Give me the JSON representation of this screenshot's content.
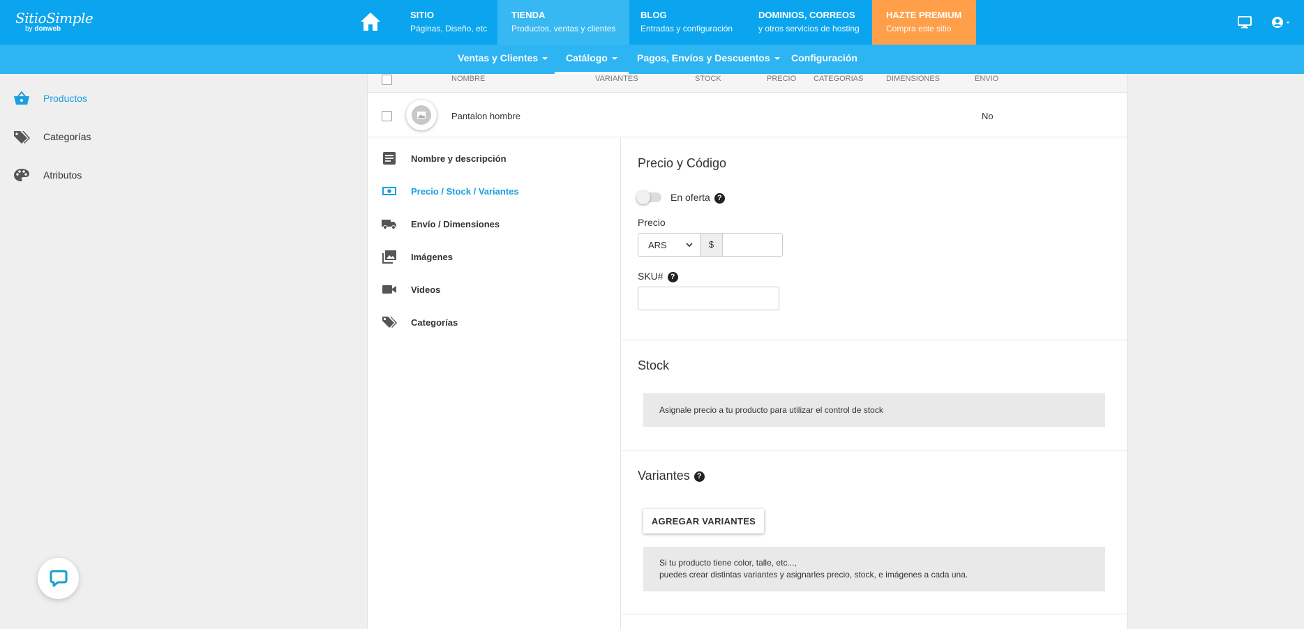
{
  "brand": {
    "logo_main": "SitioSimple",
    "logo_by": "by",
    "logo_company": "donweb"
  },
  "topnav": [
    {
      "title": "SITIO",
      "subtitle": "Páginas, Diseño, etc"
    },
    {
      "title": "TIENDA",
      "subtitle": "Productos, ventas y clientes"
    },
    {
      "title": "BLOG",
      "subtitle": "Entradas y configuración"
    },
    {
      "title": "DOMINIOS, CORREOS",
      "subtitle": "y otros servicios de hosting"
    },
    {
      "title": "HAZTE PREMIUM",
      "subtitle": "Compra este sitio"
    }
  ],
  "subnav": [
    {
      "label": "Ventas y Clientes"
    },
    {
      "label": "Catálogo"
    },
    {
      "label": "Pagos, Envíos y Descuentos"
    },
    {
      "label": "Configuración"
    }
  ],
  "sidebar": [
    {
      "label": "Productos",
      "icon": "basket-icon"
    },
    {
      "label": "Categorías",
      "icon": "tags-icon"
    },
    {
      "label": "Atributos",
      "icon": "palette-icon"
    }
  ],
  "table": {
    "headers": [
      "NOMBRE",
      "VARIANTES",
      "STOCK",
      "PRECIO",
      "CATEGORIAS",
      "DIMENSIONES",
      "ENVIO"
    ],
    "row": {
      "name": "Pantalon hombre",
      "envio": "No"
    }
  },
  "editor_menu": [
    {
      "label": "Nombre y descripción",
      "icon": "document-icon"
    },
    {
      "label": "Precio / Stock / Variantes",
      "icon": "money-icon"
    },
    {
      "label": "Envío / Dimensiones",
      "icon": "truck-icon"
    },
    {
      "label": "Imágenes",
      "icon": "images-icon"
    },
    {
      "label": "Videos",
      "icon": "video-icon"
    },
    {
      "label": "Categorías",
      "icon": "tags-icon"
    }
  ],
  "price_section": {
    "title": "Precio y Código",
    "offer_label": "En oferta",
    "offer_enabled": false,
    "price_label": "Precio",
    "currency": "ARS",
    "currency_symbol": "$",
    "price_value": "",
    "sku_label": "SKU#",
    "sku_value": ""
  },
  "stock_section": {
    "title": "Stock",
    "note": "Asignale precio a tu producto para utilizar el control de stock"
  },
  "variants_section": {
    "title": "Variantes",
    "button": "AGREGAR VARIANTES",
    "note_line1": "Si tu producto tiene color, talle, etc...,",
    "note_line2": "puedes crear distintas variantes y asignarles precio, stock, e imágenes a cada una."
  },
  "colors": {
    "topbar": "#0aa5ee",
    "subbar": "#2db4f2",
    "active_tab": "#37b8f3",
    "premium": "#ff9f4a",
    "accent_text": "#1a9fe0"
  }
}
